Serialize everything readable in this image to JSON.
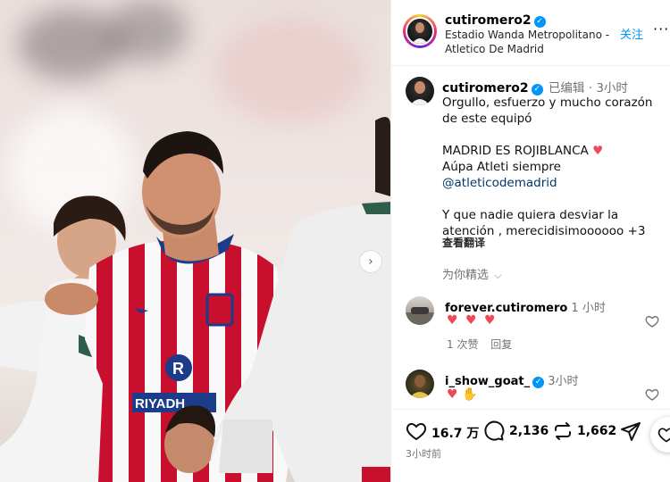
{
  "post": {
    "username": "cutiromero2",
    "location_line1": "Estadio Wanda Metropolitano -",
    "location_line2": "Atletico De Madrid",
    "follow_label": "关注",
    "more_icon": "more-horizontal-icon"
  },
  "caption": {
    "username": "cutiromero2",
    "edited_label": "已编辑",
    "dot": "·",
    "time": "3小时",
    "lines": [
      "Orgullo, esfuerzo y mucho corazón",
      "de este equipó",
      "",
      "MADRID ES ROJIBLANCA",
      "Aúpa Atleti siempre",
      "@atleticodemadrid",
      "",
      "Y que nadie quiera desviar la",
      "atención , merecidisimoooooo +3"
    ],
    "see_translation": "查看翻译",
    "for_you": "为你精选"
  },
  "comments": [
    {
      "username": "forever.cutiromero",
      "time": "1 小时",
      "text": "❤️ ❤️ ❤️",
      "likes": "1 次赞",
      "reply": "回复"
    },
    {
      "username": "i_show_goat_",
      "time": "3小时",
      "text": "❤️ 🙌"
    }
  ],
  "stats": {
    "likes": "16.7 万",
    "comments": "2,136",
    "reposts": "1,662",
    "posted": "3小时前"
  },
  "photo": {
    "sponsor_text": "RIYADH"
  },
  "colors": {
    "verified": "#0095f6",
    "like_red": "#ed4956",
    "link_blue": "#00376b",
    "muted": "#737373",
    "atletico_red": "#c8102e"
  }
}
